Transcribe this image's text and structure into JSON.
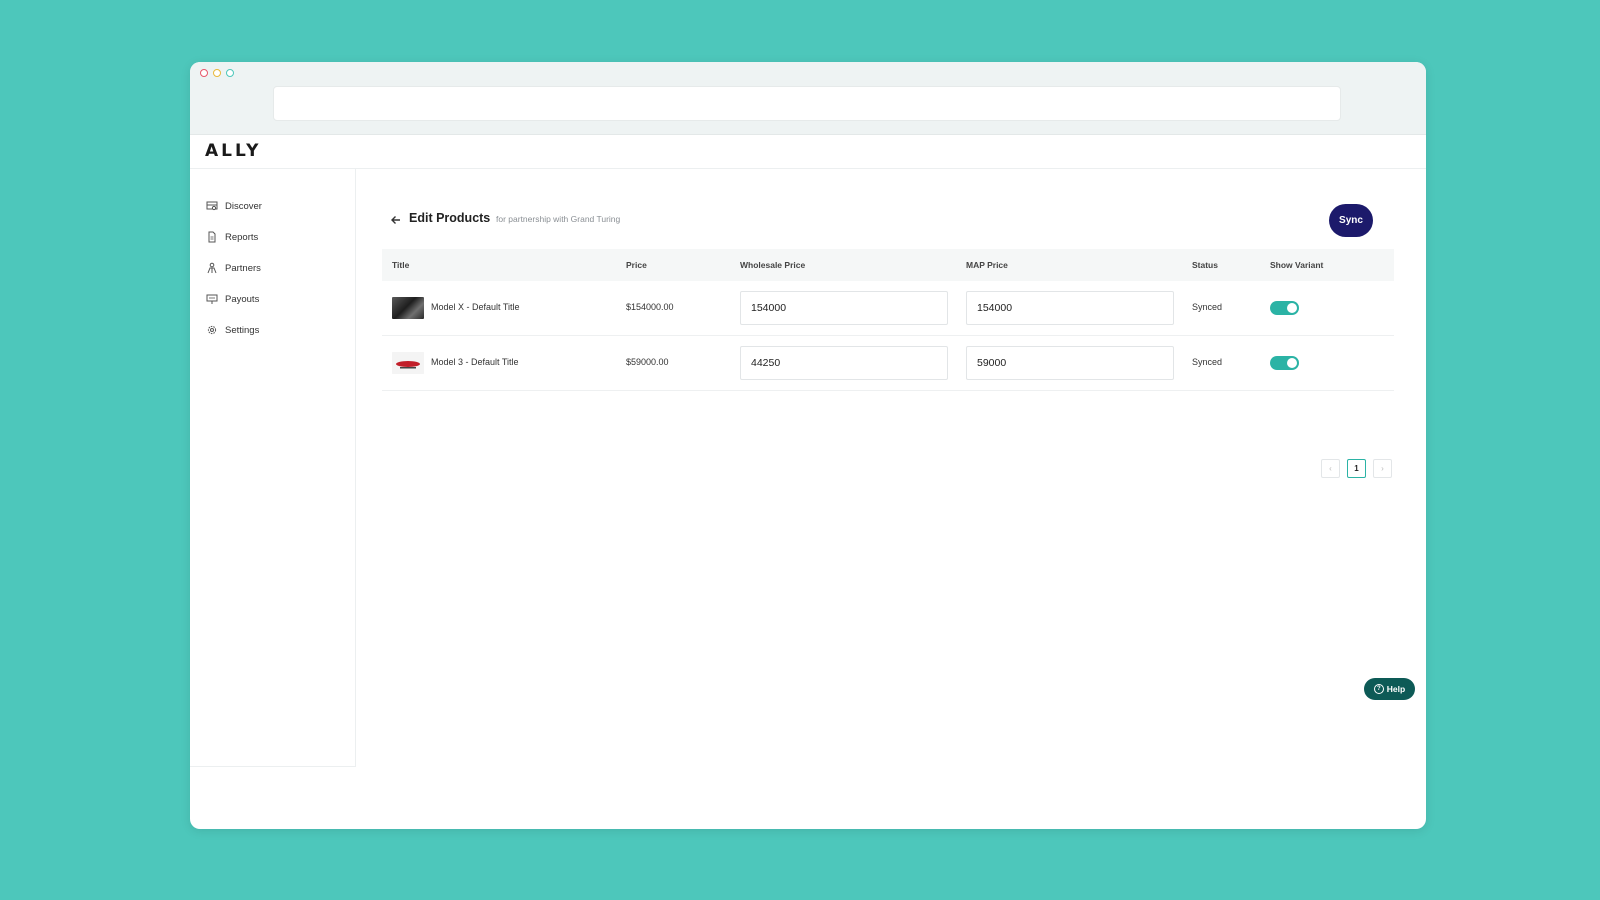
{
  "app": {
    "logo": "ALLY"
  },
  "browser": {
    "url": ""
  },
  "sidebar": {
    "items": [
      {
        "label": "Discover",
        "icon": "discover-icon"
      },
      {
        "label": "Reports",
        "icon": "document-icon"
      },
      {
        "label": "Partners",
        "icon": "partners-icon"
      },
      {
        "label": "Payouts",
        "icon": "payouts-icon"
      },
      {
        "label": "Settings",
        "icon": "gear-icon"
      }
    ]
  },
  "page": {
    "title": "Edit Products",
    "subtitle": "for partnership with Grand Turing",
    "sync_label": "Sync"
  },
  "table": {
    "columns": [
      "Title",
      "Price",
      "Wholesale Price",
      "MAP Price",
      "Status",
      "Show Variant"
    ],
    "rows": [
      {
        "title": "Model X - Default Title",
        "price": "$154000.00",
        "wholesale": "154000",
        "map": "154000",
        "status": "Synced",
        "show_variant": true
      },
      {
        "title": "Model 3 - Default Title",
        "price": "$59000.00",
        "wholesale": "44250",
        "map": "59000",
        "status": "Synced",
        "show_variant": true
      }
    ]
  },
  "pagination": {
    "prev": "‹",
    "current": "1",
    "next": "›"
  },
  "help": {
    "label": "Help",
    "icon_glyph": "?"
  },
  "colors": {
    "background": "#4dc7bb",
    "accent": "#2bb3a5",
    "sync_button": "#1c1a6b",
    "help_button": "#0d5a56"
  }
}
